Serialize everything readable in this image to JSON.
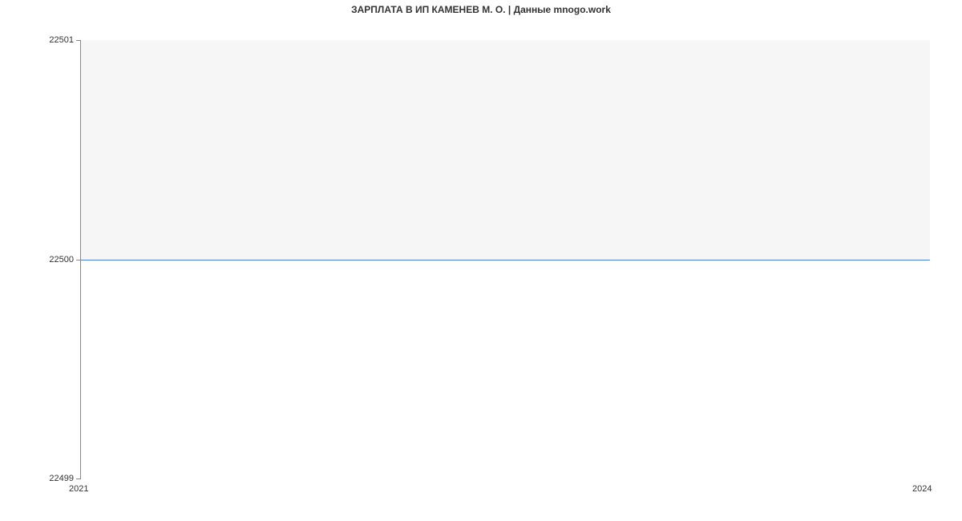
{
  "chart_data": {
    "type": "line",
    "title": "ЗАРПЛАТА В ИП КАМЕНЕВ М. О. | Данные mnogo.work",
    "xlabel": "",
    "ylabel": "",
    "x": [
      2021,
      2024
    ],
    "values": [
      22500,
      22500
    ],
    "xlim": [
      2021,
      2024
    ],
    "ylim": [
      22499,
      22501
    ],
    "x_ticks": [
      "2021",
      "2024"
    ],
    "y_ticks": [
      "22499",
      "22500",
      "22501"
    ],
    "line_color": "#4a7fe0",
    "grid": false
  }
}
